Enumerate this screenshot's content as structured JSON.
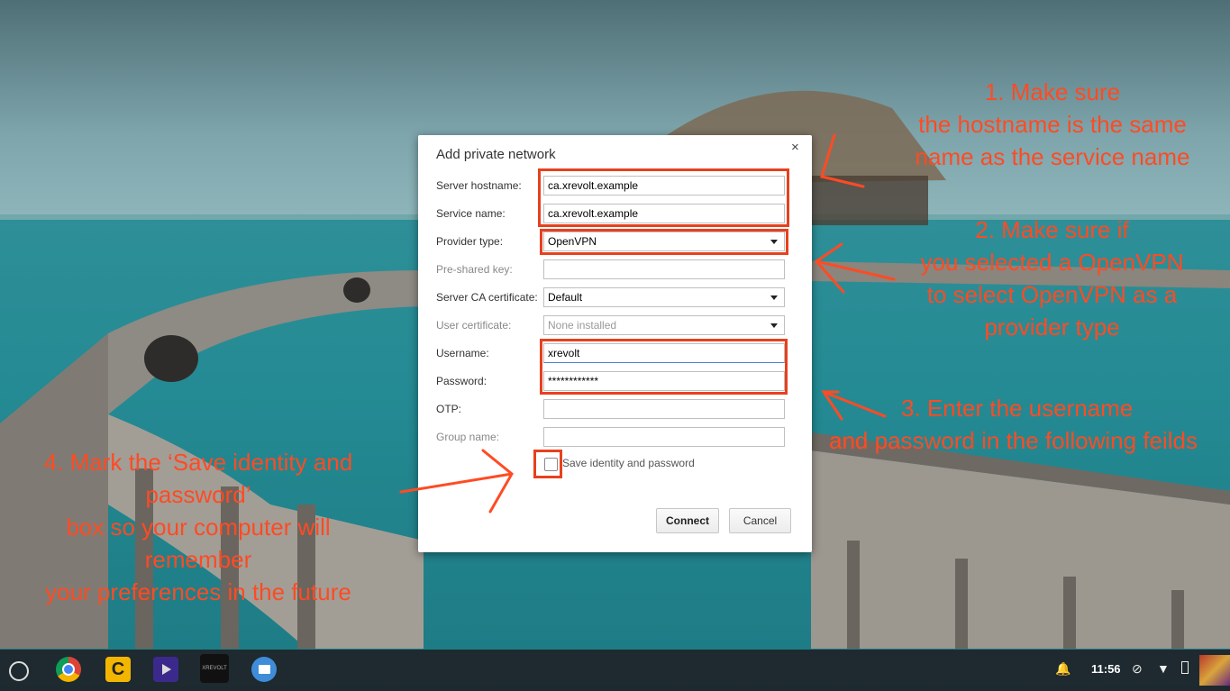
{
  "dialog": {
    "title": "Add private network",
    "close_glyph": "×",
    "fields": {
      "server_hostname": {
        "label": "Server hostname:",
        "value": "ca.xrevolt.example"
      },
      "service_name": {
        "label": "Service name:",
        "value": "ca.xrevolt.example"
      },
      "provider_type": {
        "label": "Provider type:",
        "value": "OpenVPN"
      },
      "pre_shared_key": {
        "label": "Pre-shared key:",
        "value": ""
      },
      "server_ca_certificate": {
        "label": "Server CA certificate:",
        "value": "Default"
      },
      "user_certificate": {
        "label": "User certificate:",
        "value": "None installed"
      },
      "username": {
        "label": "Username:",
        "value": "xrevolt"
      },
      "password": {
        "label": "Password:",
        "value": "************"
      },
      "otp": {
        "label": "OTP:",
        "value": ""
      },
      "group_name": {
        "label": "Group name:",
        "value": ""
      }
    },
    "save_identity": {
      "label": "Save identity and password",
      "checked": false
    },
    "buttons": {
      "connect": "Connect",
      "cancel": "Cancel"
    }
  },
  "annotations": {
    "note1": [
      "1. Make sure",
      "the hostname is the same",
      "name as the service name"
    ],
    "note2": [
      "2. Make sure if",
      "you selected a OpenVPN",
      "to select OpenVPN as a",
      "provider type"
    ],
    "note3": [
      "3. Enter the username",
      "and password in the following feilds"
    ],
    "note4": [
      "4. Mark the ‘Save identity and",
      "password’",
      "box so your computer will",
      "remember",
      "your preferences in the future"
    ],
    "color": "#ff4b24"
  },
  "shelf": {
    "apps": [
      "launcher-icon",
      "chrome-icon",
      "c-app-icon",
      "video-app-icon",
      "xrevolt-app-icon",
      "files-icon"
    ],
    "xrevolt_icon_text": "XREVOLT",
    "clock": "11:56",
    "tray_icons": [
      "notification-icon",
      "no-network-icon",
      "vpn-icon",
      "battery-icon",
      "avatar"
    ]
  }
}
